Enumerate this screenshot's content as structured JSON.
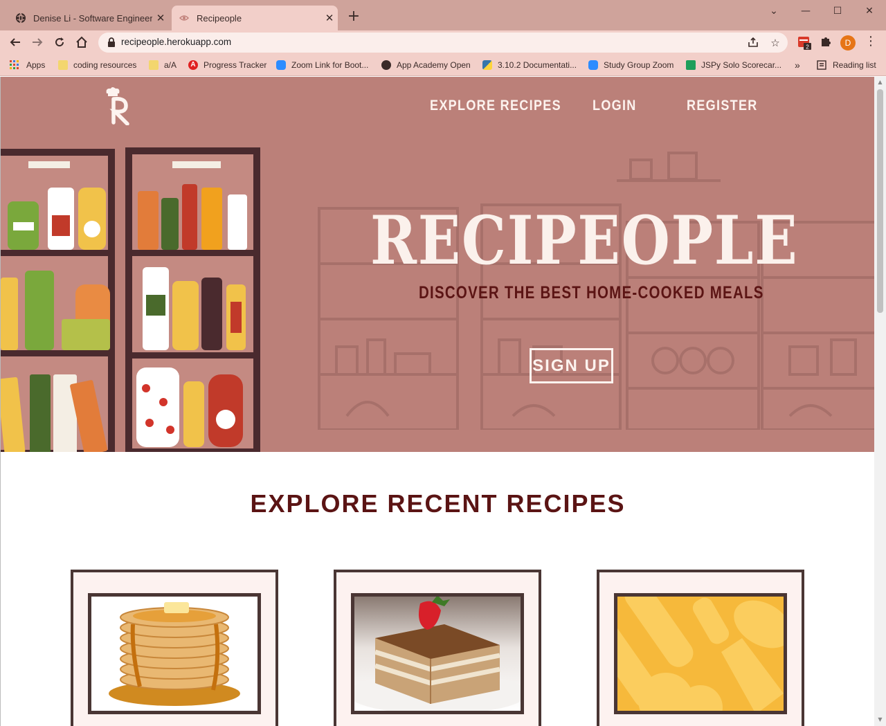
{
  "browser": {
    "tabs": [
      {
        "title": "Denise Li - Software Engineer",
        "active": false
      },
      {
        "title": "Recipeople",
        "active": true
      }
    ],
    "url": "recipeople.herokuapp.com",
    "profile_initial": "D",
    "extension_badge": "2",
    "bookmarks": [
      {
        "label": "Apps",
        "icon": "apps-grid-icon"
      },
      {
        "label": "coding resources",
        "icon": "folder-icon"
      },
      {
        "label": "a/A",
        "icon": "folder-icon"
      },
      {
        "label": "Progress Tracker",
        "icon": "red-a-icon"
      },
      {
        "label": "Zoom Link for Boot...",
        "icon": "zoom-icon"
      },
      {
        "label": "App Academy Open",
        "icon": "globe-icon"
      },
      {
        "label": "3.10.2 Documentati...",
        "icon": "python-icon"
      },
      {
        "label": "Study Group Zoom",
        "icon": "zoom-icon"
      },
      {
        "label": "JSPy Solo Scorecar...",
        "icon": "sheets-icon"
      }
    ],
    "overflow": "»",
    "reading_list": "Reading list"
  },
  "site": {
    "nav": {
      "explore": "EXPLORE RECIPES",
      "login": "LOGIN",
      "register": "REGISTER"
    },
    "hero": {
      "title": "RECIPEOPLE",
      "subtitle": "DISCOVER THE BEST HOME-COOKED MEALS",
      "cta": "SIGN UP"
    },
    "recent": {
      "heading": "EXPLORE RECENT RECIPES",
      "cards": [
        {
          "image": "pancake-stack-image"
        },
        {
          "image": "tiramisu-image"
        },
        {
          "image": "placeholder-kitchen-pattern-image"
        }
      ]
    }
  },
  "colors": {
    "hero_bg": "#bb8079",
    "title_dark": "#5b1414",
    "tab_strip": "#cfa39b",
    "toolbar": "#f2cfc9"
  }
}
